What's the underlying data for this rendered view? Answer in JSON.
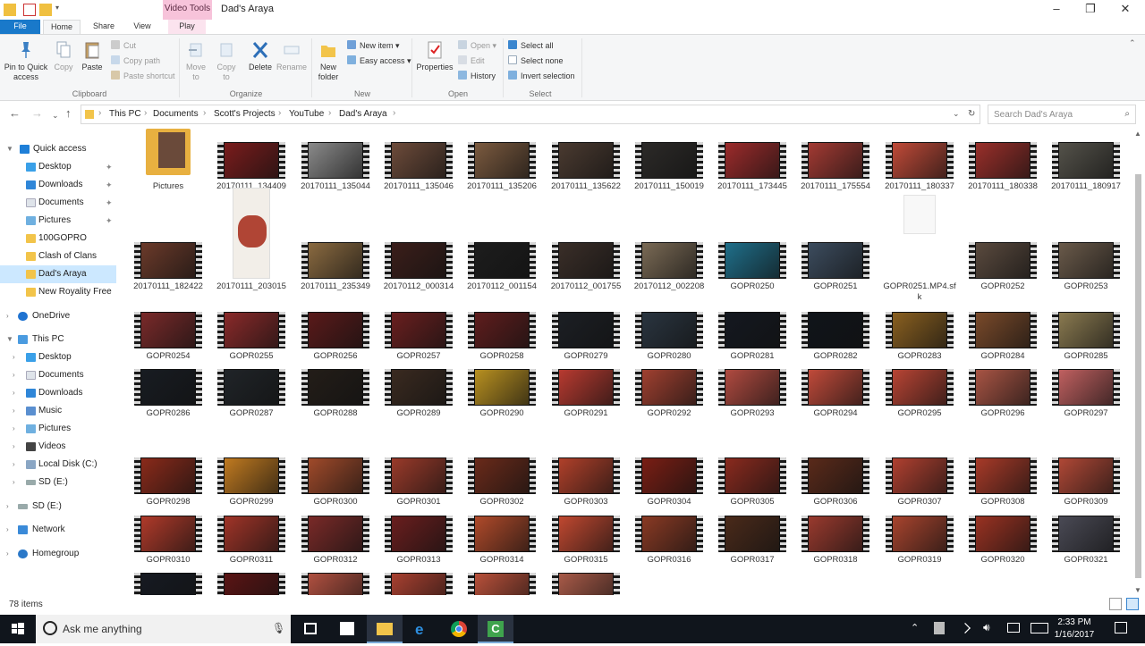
{
  "titlebar": {
    "context_tab": "Video Tools",
    "title": "Dad's Araya"
  },
  "tabs": {
    "file": "File",
    "home": "Home",
    "share": "Share",
    "view": "View",
    "play": "Play"
  },
  "ribbon": {
    "pin": "Pin to Quick access",
    "copy": "Copy",
    "paste": "Paste",
    "cut": "Cut",
    "copy_path": "Copy path",
    "paste_shortcut": "Paste shortcut",
    "move_to": "Move to",
    "copy_to": "Copy to",
    "delete": "Delete",
    "rename": "Rename",
    "new_folder": "New folder",
    "new_item": "New item",
    "easy_access": "Easy access",
    "properties": "Properties",
    "open": "Open",
    "edit": "Edit",
    "history": "History",
    "select_all": "Select all",
    "select_none": "Select none",
    "invert_selection": "Invert selection",
    "groups": {
      "clipboard": "Clipboard",
      "organize": "Organize",
      "new": "New",
      "open": "Open",
      "select": "Select"
    }
  },
  "address": {
    "crumbs": [
      "This PC",
      "Documents",
      "Scott's Projects",
      "YouTube",
      "Dad's Araya"
    ],
    "search_placeholder": "Search Dad's Araya"
  },
  "nav": {
    "quick_access": "Quick access",
    "qa_items": [
      "Desktop",
      "Downloads",
      "Documents",
      "Pictures",
      "100GOPRO",
      "Clash of Clans",
      "Dad's Araya",
      "New Royality Free"
    ],
    "onedrive": "OneDrive",
    "this_pc": "This PC",
    "pc_items": [
      "Desktop",
      "Documents",
      "Downloads",
      "Music",
      "Pictures",
      "Videos",
      "Local Disk (C:)",
      "SD (E:)"
    ],
    "sd": "SD (E:)",
    "network": "Network",
    "homegroup": "Homegroup"
  },
  "files": [
    {
      "name": "Pictures",
      "kind": "folder"
    },
    {
      "name": "20170111_134409",
      "kind": "video",
      "color": "#7a1c1c"
    },
    {
      "name": "20170111_135044",
      "kind": "video",
      "color": "#8a8a8a"
    },
    {
      "name": "20170111_135046",
      "kind": "video",
      "color": "#6d4b3a"
    },
    {
      "name": "20170111_135206",
      "kind": "video",
      "color": "#7b5a3f"
    },
    {
      "name": "20170111_135622",
      "kind": "video",
      "color": "#4a3a30"
    },
    {
      "name": "20170111_150019",
      "kind": "video",
      "color": "#2c2a28"
    },
    {
      "name": "20170111_173445",
      "kind": "video",
      "color": "#9c2b2b"
    },
    {
      "name": "20170111_175554",
      "kind": "video",
      "color": "#a33a33"
    },
    {
      "name": "20170111_180337",
      "kind": "video",
      "color": "#c04a38"
    },
    {
      "name": "20170111_180338",
      "kind": "video",
      "color": "#9a2f2a"
    },
    {
      "name": "20170111_180917",
      "kind": "video",
      "color": "#54524a"
    },
    {
      "name": "20170111_182422",
      "kind": "video",
      "color": "#6b3a2a"
    },
    {
      "name": "20170111_203015",
      "kind": "photo",
      "color": "#b04535"
    },
    {
      "name": "20170111_235349",
      "kind": "video",
      "color": "#8a6a40"
    },
    {
      "name": "20170112_000314",
      "kind": "video",
      "color": "#3b1e1a"
    },
    {
      "name": "20170112_001154",
      "kind": "video",
      "color": "#1d1d1d"
    },
    {
      "name": "20170112_001755",
      "kind": "video",
      "color": "#3a2e28"
    },
    {
      "name": "20170112_002208",
      "kind": "video",
      "color": "#7a6a55"
    },
    {
      "name": "GOPR0250",
      "kind": "video",
      "color": "#1f6f8a"
    },
    {
      "name": "GOPR0251",
      "kind": "video",
      "color": "#3c4c5e"
    },
    {
      "name": "GOPR0251.MP4.sfk",
      "kind": "doc"
    },
    {
      "name": "GOPR0252",
      "kind": "video",
      "color": "#5a4a3e"
    },
    {
      "name": "GOPR0253",
      "kind": "video",
      "color": "#6a5a4a"
    },
    {
      "name": "GOPR0254",
      "kind": "video",
      "color": "#7a2a2a"
    },
    {
      "name": "GOPR0255",
      "kind": "video",
      "color": "#8a2a2a"
    },
    {
      "name": "GOPR0256",
      "kind": "video",
      "color": "#5a1a1a"
    },
    {
      "name": "GOPR0257",
      "kind": "video",
      "color": "#6a1f1f"
    },
    {
      "name": "GOPR0258",
      "kind": "video",
      "color": "#5f1d1d"
    },
    {
      "name": "GOPR0279",
      "kind": "video",
      "color": "#1c1f24"
    },
    {
      "name": "GOPR0280",
      "kind": "video",
      "color": "#2a3540"
    },
    {
      "name": "GOPR0281",
      "kind": "video",
      "color": "#141820"
    },
    {
      "name": "GOPR0282",
      "kind": "video",
      "color": "#10141a"
    },
    {
      "name": "GOPR0283",
      "kind": "video",
      "color": "#8a6020"
    },
    {
      "name": "GOPR0284",
      "kind": "video",
      "color": "#7a4a2a"
    },
    {
      "name": "GOPR0285",
      "kind": "video",
      "color": "#8a7a50"
    },
    {
      "name": "GOPR0286",
      "kind": "video",
      "color": "#181c22"
    },
    {
      "name": "GOPR0287",
      "kind": "video",
      "color": "#202428"
    },
    {
      "name": "GOPR0288",
      "kind": "video",
      "color": "#231d18"
    },
    {
      "name": "GOPR0289",
      "kind": "video",
      "color": "#3a2a20"
    },
    {
      "name": "GOPR0290",
      "kind": "video",
      "color": "#b89020"
    },
    {
      "name": "GOPR0291",
      "kind": "video",
      "color": "#b83a30"
    },
    {
      "name": "GOPR0292",
      "kind": "video",
      "color": "#a04030"
    },
    {
      "name": "GOPR0293",
      "kind": "video",
      "color": "#b04a40"
    },
    {
      "name": "GOPR0294",
      "kind": "video",
      "color": "#c04a3a"
    },
    {
      "name": "GOPR0295",
      "kind": "video",
      "color": "#b84434"
    },
    {
      "name": "GOPR0296",
      "kind": "video",
      "color": "#a85444"
    },
    {
      "name": "GOPR0297",
      "kind": "video",
      "color": "#c06060"
    },
    {
      "name": "GOPR0298",
      "kind": "video",
      "color": "#8a2a1a"
    },
    {
      "name": "GOPR0299",
      "kind": "video",
      "color": "#c07a20"
    },
    {
      "name": "GOPR0300",
      "kind": "video",
      "color": "#a04a2a"
    },
    {
      "name": "GOPR0301",
      "kind": "video",
      "color": "#9a3a2a"
    },
    {
      "name": "GOPR0302",
      "kind": "video",
      "color": "#6a2a1a"
    },
    {
      "name": "GOPR0303",
      "kind": "video",
      "color": "#b0402a"
    },
    {
      "name": "GOPR0304",
      "kind": "video",
      "color": "#7a1e14"
    },
    {
      "name": "GOPR0305",
      "kind": "video",
      "color": "#8a2a1e"
    },
    {
      "name": "GOPR0306",
      "kind": "video",
      "color": "#5a2a1a"
    },
    {
      "name": "GOPR0307",
      "kind": "video",
      "color": "#b04030"
    },
    {
      "name": "GOPR0308",
      "kind": "video",
      "color": "#a83a28"
    },
    {
      "name": "GOPR0309",
      "kind": "video",
      "color": "#b04836"
    },
    {
      "name": "GOPR0310",
      "kind": "video",
      "color": "#b03a2a"
    },
    {
      "name": "GOPR0311",
      "kind": "video",
      "color": "#a03428"
    },
    {
      "name": "GOPR0312",
      "kind": "video",
      "color": "#7a2a28"
    },
    {
      "name": "GOPR0313",
      "kind": "video",
      "color": "#6a1e1e"
    },
    {
      "name": "GOPR0314",
      "kind": "video",
      "color": "#b04a2a"
    },
    {
      "name": "GOPR0315",
      "kind": "video",
      "color": "#c04830"
    },
    {
      "name": "GOPR0316",
      "kind": "video",
      "color": "#8a3a24"
    },
    {
      "name": "GOPR0317",
      "kind": "video",
      "color": "#4a2a1a"
    },
    {
      "name": "GOPR0318",
      "kind": "video",
      "color": "#9a3a2e"
    },
    {
      "name": "GOPR0319",
      "kind": "video",
      "color": "#a8442e"
    },
    {
      "name": "GOPR0320",
      "kind": "video",
      "color": "#9a3222"
    },
    {
      "name": "GOPR0321",
      "kind": "video",
      "color": "#4a4a55"
    },
    {
      "name": "",
      "kind": "video",
      "color": "#161a22"
    },
    {
      "name": "",
      "kind": "video",
      "color": "#5a1414"
    },
    {
      "name": "",
      "kind": "video",
      "color": "#b05040"
    },
    {
      "name": "",
      "kind": "video",
      "color": "#a84030"
    },
    {
      "name": "",
      "kind": "video",
      "color": "#b8503a"
    },
    {
      "name": "",
      "kind": "video",
      "color": "#a85a48"
    }
  ],
  "status": {
    "items": "78 items"
  },
  "taskbar": {
    "search_placeholder": "Ask me anything",
    "time": "2:33 PM",
    "date": "1/16/2017"
  },
  "colors": {
    "accent": "#1979ca",
    "selection": "#cce8ff",
    "taskbar": "#10151c"
  }
}
